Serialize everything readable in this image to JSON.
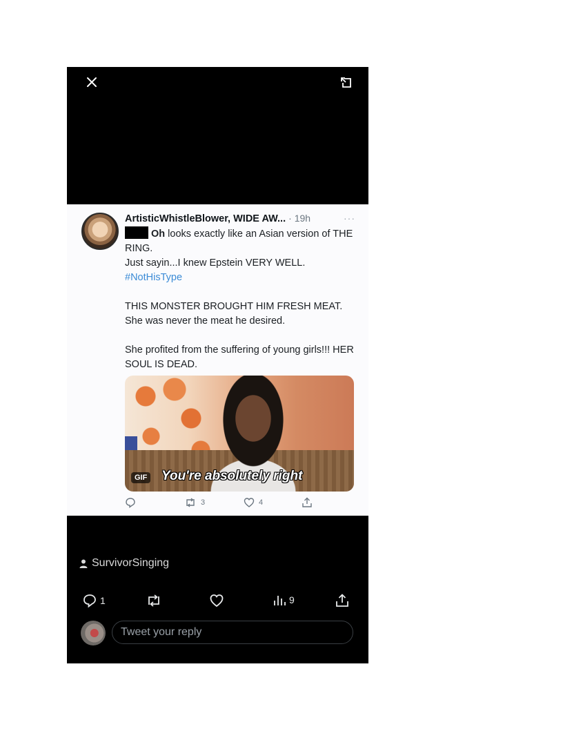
{
  "viewer": {
    "close_icon": "close-icon",
    "expand_icon": "expand-icon"
  },
  "embedded_tweet": {
    "author": "ArtisticWhistleBlower, WIDE AW...",
    "time": "· 19h",
    "more": "···",
    "lead_bold": "Oh",
    "line1": " looks exactly like an Asian version of THE RING.",
    "line2": "Just sayin...I knew Epstein VERY WELL.",
    "hashtag": "#NotHisType",
    "para2": "THIS MONSTER BROUGHT HIM FRESH MEAT. She was never the meat he desired.",
    "para3": "She profited from the suffering of young girls!!! HER SOUL IS DEAD.",
    "gif_badge": "GIF",
    "gif_caption": "You're absolutely right",
    "retweets": "3",
    "likes": "4"
  },
  "post": {
    "username": "SurvivorSinging",
    "replies": "1",
    "views": "9"
  },
  "reply": {
    "placeholder": "Tweet your reply"
  },
  "colors": {
    "background": "#000000",
    "link": "#3b8bd6"
  }
}
